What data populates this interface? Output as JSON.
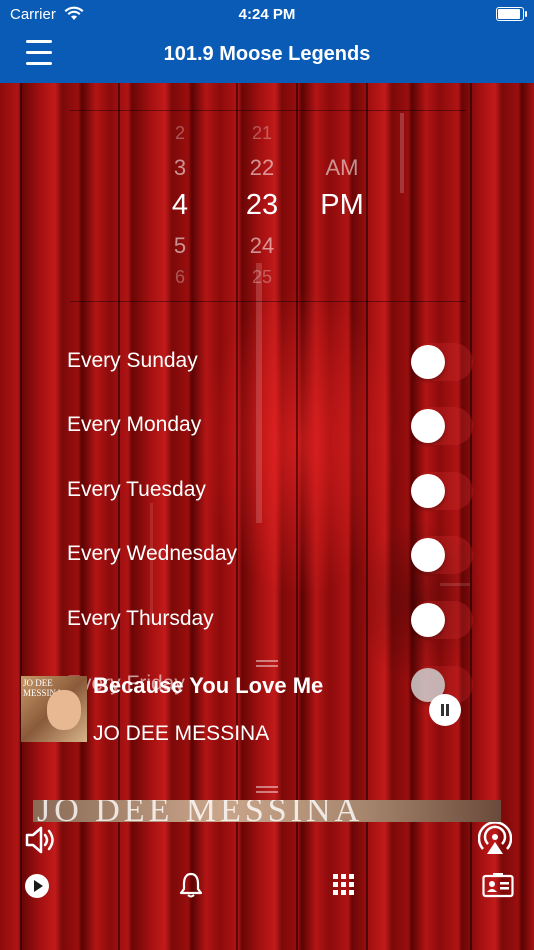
{
  "status": {
    "carrier": "Carrier",
    "time": "4:24 PM"
  },
  "nav": {
    "title": "101.9 Moose Legends"
  },
  "picker": {
    "hours": [
      "2",
      "3",
      "4",
      "5",
      "6"
    ],
    "minutes": [
      "21",
      "22",
      "23",
      "24",
      "25"
    ],
    "ampm": [
      "AM",
      "PM"
    ],
    "selected": {
      "hour": "4",
      "minute": "23",
      "ampm": "PM"
    }
  },
  "days": [
    {
      "label": "Every Sunday",
      "on": false
    },
    {
      "label": "Every Monday",
      "on": false
    },
    {
      "label": "Every Tuesday",
      "on": false
    },
    {
      "label": "Every Wednesday",
      "on": false
    },
    {
      "label": "Every Thursday",
      "on": false
    },
    {
      "label": "Every Friday",
      "on": false
    }
  ],
  "now_playing": {
    "title": "Because You Love Me",
    "artist": "JO DEE MESSINA",
    "art_text": "JO DEE MESSINA",
    "banner_text": "JO DEE MESSINA"
  },
  "icons": {
    "menu": "hamburger-icon",
    "volume": "speaker-icon",
    "airplay": "airplay-icon",
    "play": "play-icon",
    "alarm": "bell-icon",
    "grid": "grid-icon",
    "contact": "contact-card-icon"
  },
  "colors": {
    "nav": "#0a5bb6",
    "accent": "#ffffff"
  }
}
